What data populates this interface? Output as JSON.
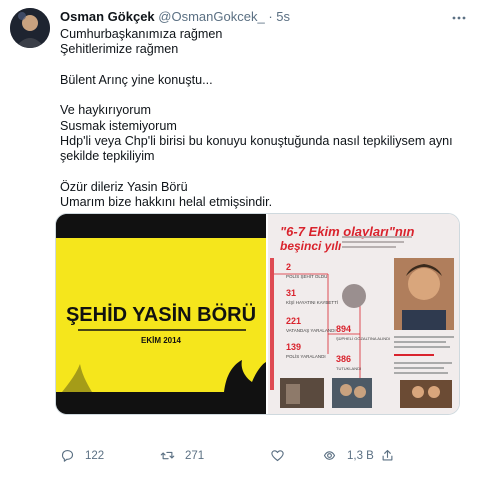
{
  "tweet": {
    "author_name": "Osman Gökçek",
    "handle": "@OsmanGokcek_",
    "separator": "·",
    "time": "5s",
    "more_icon": "more-horizontal-icon",
    "lines": [
      "Cumhurbaşkanımıza rağmen",
      "Şehitlerimize rağmen",
      "",
      "Bülent Arınç yine konuştu...",
      "",
      "Ve haykırıyorum",
      "Susmak istemiyorum",
      "Hdp'li veya Chp'li birisi bu konuyu konuştuğunda nasıl tepkiliysem aynı",
      "şekilde tepkiliyim",
      "",
      "Özür dileriz Yasin Börü",
      "Umarım bize hakkını helal etmişsindir."
    ]
  },
  "media": {
    "left": {
      "title": "ŞEHİD YASİN BÖRÜ",
      "subtitle": "EKİM 2014",
      "accent": "#f5e61c"
    },
    "right": {
      "headline_1": "\"6-7 Ekim olayları\"nın",
      "headline_2": "beşinci yılı",
      "stats": [
        {
          "value": "2",
          "label": "POLİS ŞEHİT OLDU"
        },
        {
          "value": "31",
          "label": "KİŞİ HAYATINI KAYBETTİ"
        },
        {
          "value": "221",
          "label": "VATANDAŞ YARALANDI"
        },
        {
          "value": "139",
          "label": "POLİS YARALANDI"
        },
        {
          "value": "894",
          "label": "ŞÜPHELİ GÖZALTINA ALINDI"
        },
        {
          "value": "386",
          "label": "TUTUKLANDI"
        }
      ],
      "accent": "#d9232d"
    }
  },
  "actions": {
    "reply": {
      "icon": "reply-icon",
      "count": "122"
    },
    "retweet": {
      "icon": "retweet-icon",
      "count": "271"
    },
    "like": {
      "icon": "heart-icon",
      "count": ""
    },
    "views": {
      "icon": "views-icon",
      "count": "1,3 B"
    },
    "share": {
      "icon": "share-icon",
      "count": ""
    }
  },
  "colors": {
    "text": "#0f1419",
    "muted": "#5b7083",
    "border": "#cfd9de"
  }
}
